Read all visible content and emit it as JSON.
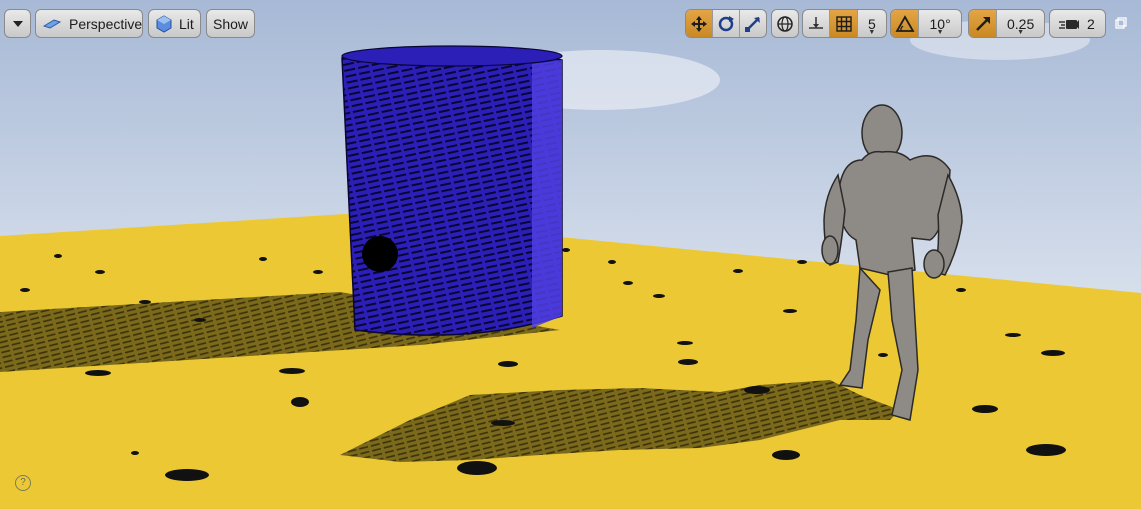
{
  "toolbar": {
    "perspective_label": "Perspective",
    "lit_label": "Lit",
    "show_label": "Show",
    "grid_snap_value": "5",
    "rotation_snap_value": "10°",
    "scale_snap_value": "0.25",
    "camera_speed_value": "2"
  },
  "icons": {
    "dropdown": "chevron-down-icon",
    "perspective": "perspective-cube-icon",
    "lit": "lit-sphere-icon",
    "translate": "translate-arrows-icon",
    "rotate": "rotate-icon",
    "scale": "scale-icon",
    "world": "world-globe-icon",
    "surface_snap": "surface-snap-icon",
    "grid": "grid-icon",
    "rotation_snap": "angle-icon",
    "scale_snap": "scale-arrow-icon",
    "camera_speed": "camera-speed-icon",
    "maximize": "maximize-icon",
    "help": "help-icon"
  },
  "colors": {
    "active_toggle": "#d69a36",
    "ground": "#ecc934",
    "cylinder": "#2b1fb8",
    "mannequin": "#8e8a86"
  },
  "help_glyph": "?"
}
